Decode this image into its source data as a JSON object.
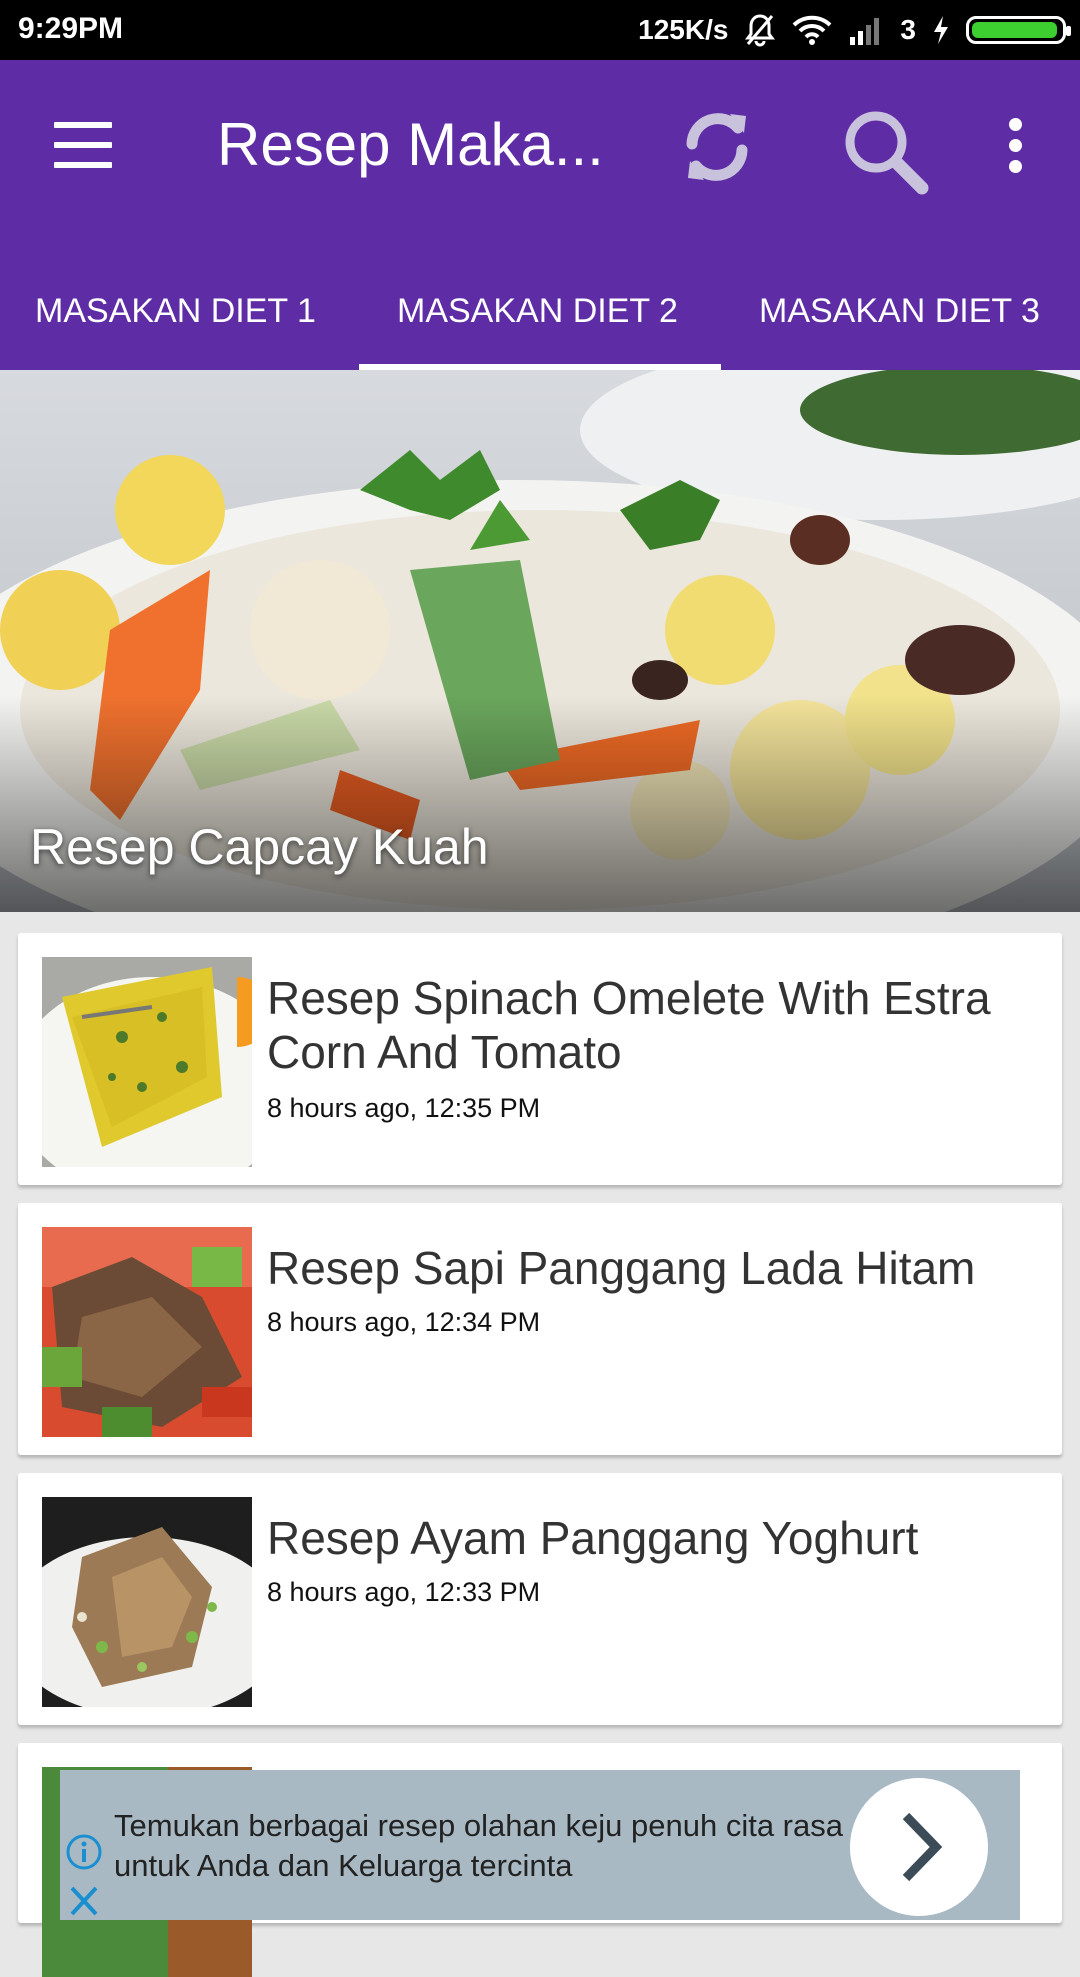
{
  "status_bar": {
    "time": "9:29PM",
    "speed": "125K/s",
    "sim": "3"
  },
  "app_bar": {
    "title": "Resep Maka...",
    "color": "#5e2ca5",
    "tabs": [
      {
        "label": "MASAKAN DIET 1"
      },
      {
        "label": "MASAKAN DIET 2",
        "selected": true
      },
      {
        "label": "MASAKAN DIET 3"
      }
    ]
  },
  "hero": {
    "title": "Resep Capcay Kuah"
  },
  "recipes": [
    {
      "title": "Resep Spinach Omelete With Estra Corn And Tomato",
      "time": "8 hours ago, 12:35 PM"
    },
    {
      "title": "Resep Sapi Panggang Lada Hitam",
      "time": "8 hours ago, 12:34 PM"
    },
    {
      "title": "Resep Ayam Panggang Yoghurt",
      "time": "8 hours ago, 12:33 PM"
    }
  ],
  "ad": {
    "text": "Temukan berbagai resep olahan keju penuh cita rasa untuk Anda dan Keluarga tercinta"
  }
}
